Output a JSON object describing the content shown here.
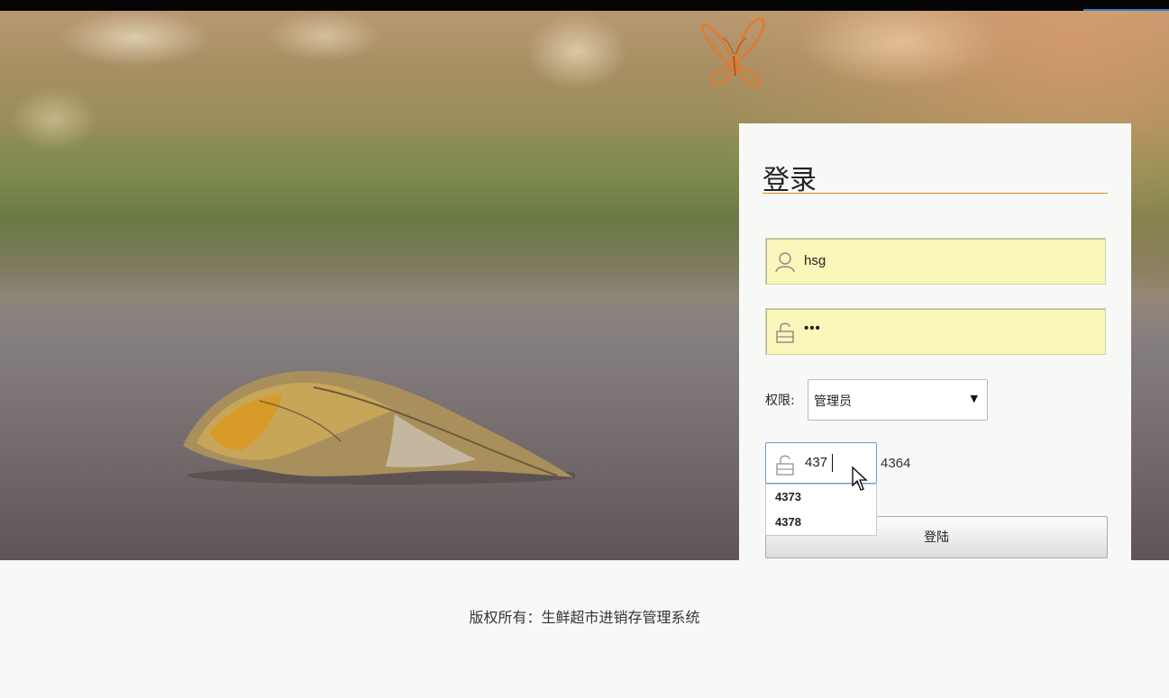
{
  "login": {
    "title": "登录",
    "username_value": "hsg",
    "password_masked": "•••",
    "permission_label": "权限:",
    "permission_selected": "管理员",
    "captcha_value": "437",
    "captcha_code": "4364",
    "captcha_suggestions": [
      "4373",
      "4378"
    ],
    "submit_label": "登陆"
  },
  "footer": {
    "copyright": "版权所有：生鲜超市进销存管理系统"
  },
  "icons": {
    "username": "user-icon",
    "password": "lock-icon",
    "captcha": "lock-icon",
    "dropdown": "triangle-down-icon",
    "logo": "butterfly-icon"
  },
  "colors": {
    "accent": "#e08a24",
    "field_bg": "#fbf7ba",
    "focus_border": "#6b9bd6"
  }
}
